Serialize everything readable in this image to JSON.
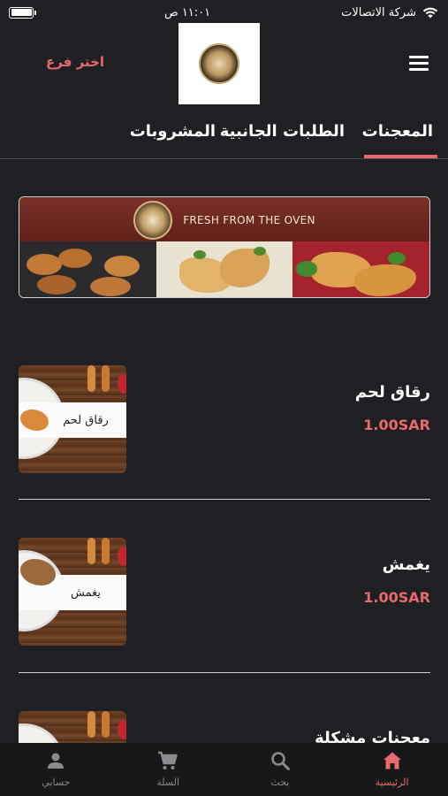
{
  "status_bar": {
    "carrier": "شركة الاتصالات",
    "time": "١١:٠١ ص"
  },
  "header": {
    "branch_label": "اختر فرع"
  },
  "tabs": [
    {
      "label": "المعجنات",
      "active": true
    },
    {
      "label": "الطلبات الجانبية",
      "active": false
    },
    {
      "label": "المشروبات",
      "active": false
    }
  ],
  "banner": {
    "text": "FRESH FROM THE OVEN"
  },
  "products": [
    {
      "name": "رقاق لحم",
      "price": "1.00SAR",
      "thumb_label": "رقاق لحم"
    },
    {
      "name": "يغمش",
      "price": "1.00SAR",
      "thumb_label": "يغمش"
    },
    {
      "name": "معجنات مشكلة",
      "price": "",
      "thumb_label": ""
    }
  ],
  "bottom_nav": [
    {
      "label": "الرئيسية",
      "icon": "home-icon",
      "active": true
    },
    {
      "label": "بحث",
      "icon": "search-icon",
      "active": false
    },
    {
      "label": "السلة",
      "icon": "cart-icon",
      "active": false
    },
    {
      "label": "حسابي",
      "icon": "account-icon",
      "active": false
    }
  ],
  "colors": {
    "background": "#1f2023",
    "accent": "#e96a6e",
    "nav_background": "#17181a"
  }
}
